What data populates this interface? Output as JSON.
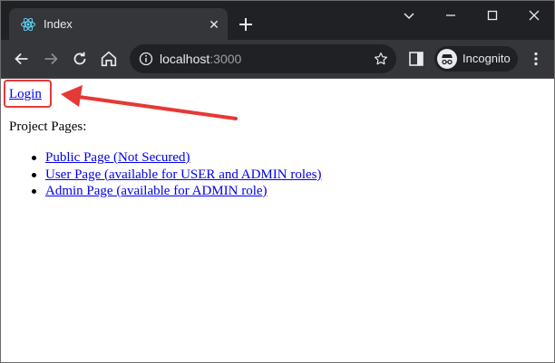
{
  "browser": {
    "tab": {
      "title": "Index",
      "favicon": "react-icon",
      "close": "✕"
    },
    "new_tab": "plus-icon",
    "controls": [
      "chevron-down-icon",
      "minimize-icon",
      "maximize-icon",
      "close-icon"
    ],
    "toolbar": {
      "url_host": "localhost",
      "url_port": ":3000",
      "profile_label": "Incognito"
    }
  },
  "page": {
    "login_label": "Login",
    "projects_heading": "Project Pages:",
    "links": [
      "Public Page (Not Secured)",
      "User Page (available for USER and ADMIN roles)",
      "Admin Page (available for ADMIN role)"
    ]
  },
  "colors": {
    "link": "#0000ee",
    "annotation": "#e53935",
    "chrome_dark": "#202124",
    "chrome_toolbar": "#35363a"
  }
}
